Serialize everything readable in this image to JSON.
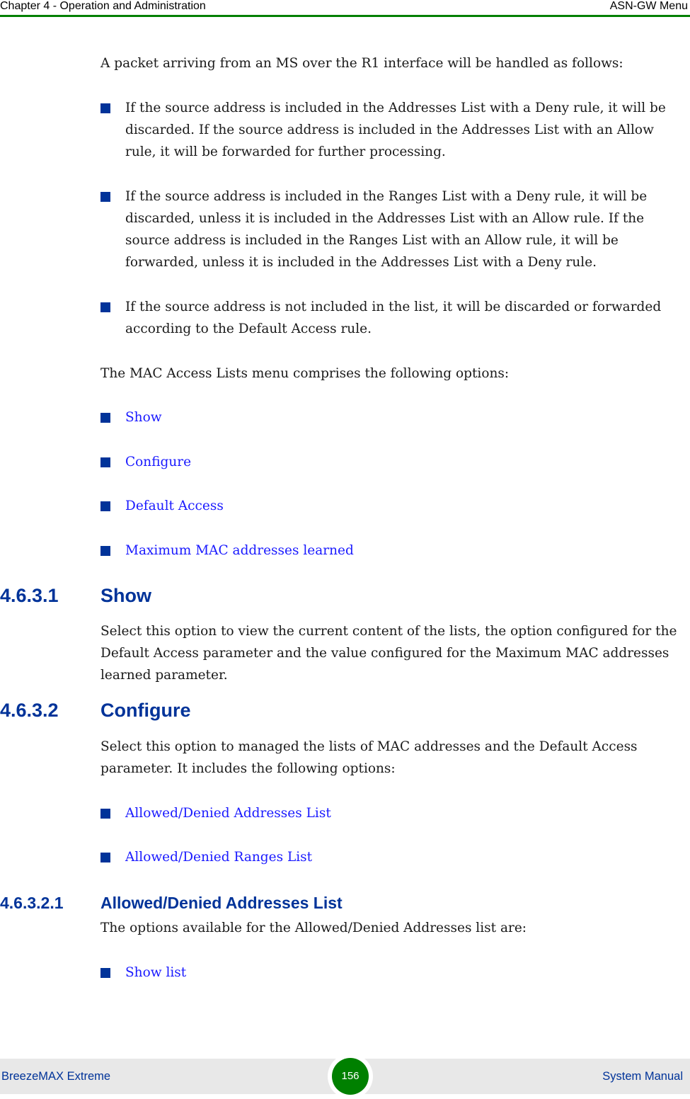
{
  "header": {
    "chapter": "Chapter 4 - Operation and Administration",
    "section": "ASN-GW Menu"
  },
  "colors": {
    "accent_green": "#008000",
    "heading_blue": "#003399",
    "link_blue": "#1a1aff",
    "footer_bg": "#e8e8e8"
  },
  "content": {
    "intro": "A packet arriving from an MS over the R1 interface will be handled as follows:",
    "rules": [
      "If the source address is included in the Addresses List with a Deny rule, it will be discarded. If the source address is included in the Addresses List with an Allow rule, it will be forwarded for further processing.",
      "If the source address is included in the Ranges List with a Deny rule, it will be discarded, unless it is included in the Addresses List with an Allow rule. If the source address is included in the Ranges List with an Allow rule, it will be forwarded, unless it is included in the Addresses List with a Deny rule.",
      "If the source address is not included in the list, it will be discarded or forwarded according to the Default Access rule."
    ],
    "menu_intro": "The MAC Access Lists menu comprises the following options:",
    "menu_options": [
      "Show",
      "Configure",
      "Default Access",
      "Maximum MAC addresses learned"
    ],
    "section_show": {
      "number": "4.6.3.1",
      "title": "Show",
      "body": "Select this option to view the current content of the lists, the option configured for the Default Access parameter and the value configured for the Maximum MAC addresses learned parameter."
    },
    "section_configure": {
      "number": "4.6.3.2",
      "title": "Configure",
      "body": "Select this option to managed the lists of MAC addresses and the Default Access parameter. It includes the following options:",
      "options": [
        "Allowed/Denied Addresses List",
        "Allowed/Denied Ranges List"
      ]
    },
    "section_addresses_list": {
      "number": "4.6.3.2.1",
      "title": "Allowed/Denied Addresses List",
      "body": "The options available for the Allowed/Denied Addresses list are:",
      "options": [
        "Show list"
      ]
    }
  },
  "footer": {
    "product": "BreezeMAX Extreme",
    "page_number": "156",
    "doc_type": "System Manual"
  }
}
